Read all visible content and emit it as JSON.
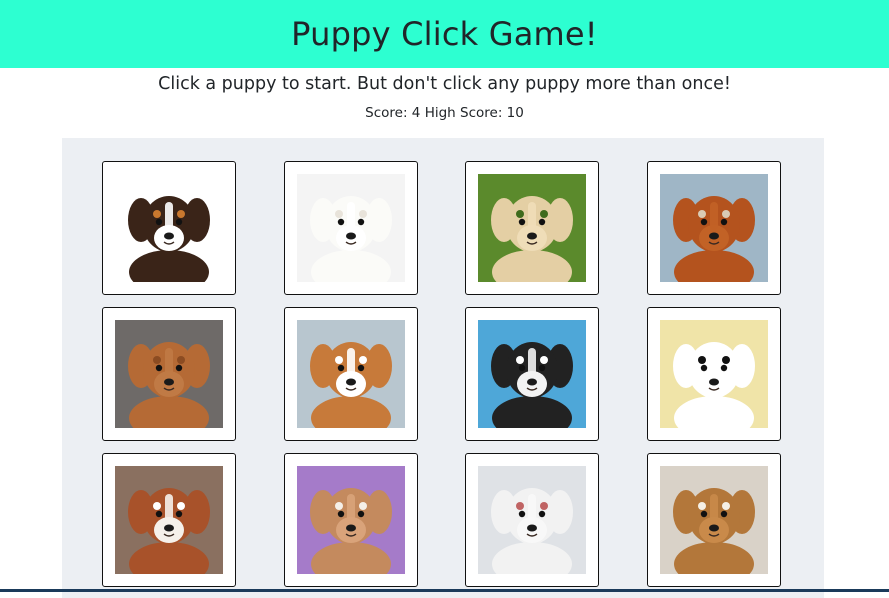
{
  "header": {
    "title": "Puppy Click Game!",
    "background": "#2dffd1"
  },
  "instructions": "Click a puppy to start. But don't click any puppy more than once!",
  "score": {
    "score_label": "Score:",
    "score_value": "4",
    "high_label": "High Score:",
    "high_value": "10"
  },
  "puppies": [
    {
      "id": "bernese-puppy",
      "bg": "#ffffff",
      "fur": "#3a2418",
      "accent": "#c9782e",
      "face": "#ffffff"
    },
    {
      "id": "white-fluffy-puppy",
      "bg": "#f4f4f4",
      "fur": "#fbfbf8",
      "accent": "#e8e3da",
      "face": "#ffffff"
    },
    {
      "id": "yellow-lab-in-grass",
      "bg": "#5b8a2c",
      "fur": "#e4cfa4",
      "accent": "#3f6b1c",
      "face": "#efddb8"
    },
    {
      "id": "cavalier-on-beach",
      "bg": "#9fb6c6",
      "fur": "#b4531e",
      "accent": "#d9cbb5",
      "face": "#c26226"
    },
    {
      "id": "vizsla-puppy",
      "bg": "#6e6a68",
      "fur": "#b56a35",
      "accent": "#8c4c22",
      "face": "#c07a45"
    },
    {
      "id": "corgi-puppy",
      "bg": "#b8c6cf",
      "fur": "#c77a3a",
      "accent": "#ffffff",
      "face": "#ffffff"
    },
    {
      "id": "french-bulldog",
      "bg": "#4ea7d8",
      "fur": "#222222",
      "accent": "#ffffff",
      "face": "#f2f2f2"
    },
    {
      "id": "dalmatian-puppy",
      "bg": "#f0e4a8",
      "fur": "#ffffff",
      "accent": "#111111",
      "face": "#ffffff"
    },
    {
      "id": "basset-hound-puppy",
      "bg": "#8a7060",
      "fur": "#a8522a",
      "accent": "#ffffff",
      "face": "#f5f0ea"
    },
    {
      "id": "pitbull-puppy-on-purple",
      "bg": "#a57bc9",
      "fur": "#c48a5e",
      "accent": "#f4efe8",
      "face": "#d9a37a"
    },
    {
      "id": "yawning-puppy-in-blanket",
      "bg": "#dfe2e6",
      "fur": "#f2f2f2",
      "accent": "#c06464",
      "face": "#f8f8f8"
    },
    {
      "id": "sheltie-puppy",
      "bg": "#d9d2c8",
      "fur": "#b3773a",
      "accent": "#f5f0e6",
      "face": "#c98a4a"
    }
  ]
}
